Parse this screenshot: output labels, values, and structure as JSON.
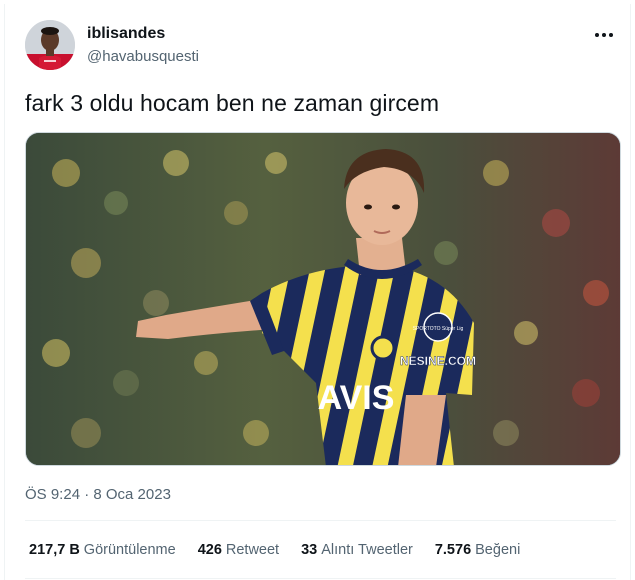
{
  "tweet": {
    "display_name": "iblisandes",
    "handle": "@havabusquesti",
    "text": "fark 3 oldu hocam ben ne zaman gircem",
    "timestamp": "ÖS 9:24 · 8 Oca 2023",
    "media_jersey_sponsor": "NESINE.COM",
    "media_jersey_front": "AVIS",
    "media_jersey_badge": "SPORTOTO Süper Lig"
  },
  "stats": [
    {
      "count": "217,7 B",
      "label": "Görüntülenme"
    },
    {
      "count": "426",
      "label": "Retweet"
    },
    {
      "count": "33",
      "label": "Alıntı Tweetler"
    },
    {
      "count": "7.576",
      "label": "Beğeni"
    }
  ],
  "icons": {
    "more": "more-horizontal-icon"
  },
  "colors": {
    "text": "#0f1419",
    "secondary": "#536471",
    "border": "#eff3f4",
    "jersey_navy": "#1b2a5c",
    "jersey_yellow": "#f4e04d"
  }
}
